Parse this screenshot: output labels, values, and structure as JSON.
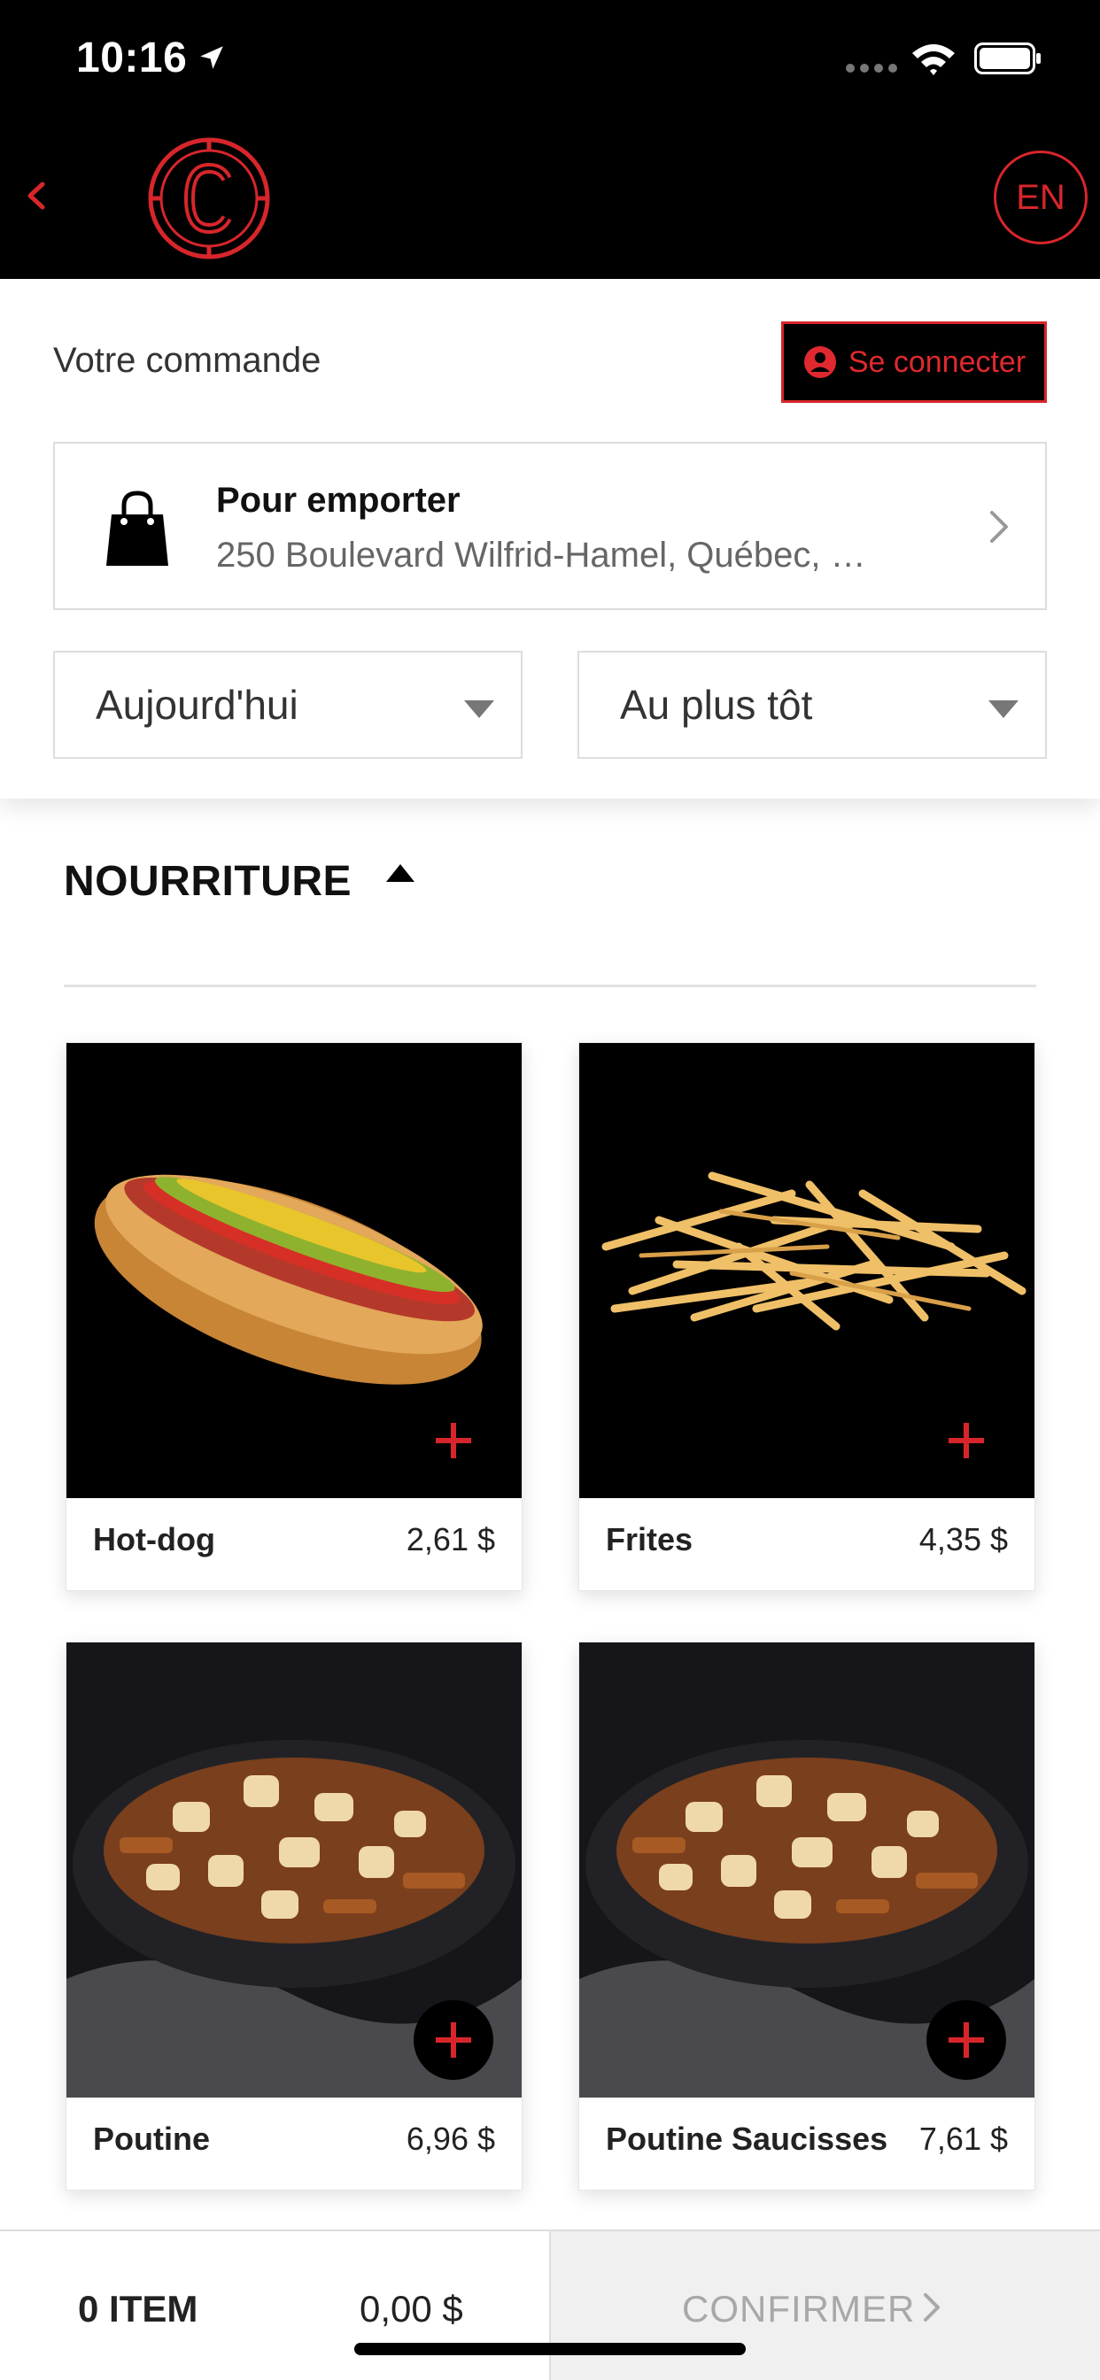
{
  "status_bar": {
    "time": "10:16"
  },
  "header": {
    "lang_label": "EN",
    "logo_letter": "C"
  },
  "order": {
    "title": "Votre commande",
    "login_label": "Se connecter",
    "pickup_title": "Pour emporter",
    "pickup_address": "250 Boulevard Wilfrid-Hamel, Québec, …",
    "date_value": "Aujourd'hui",
    "time_value": "Au plus tôt"
  },
  "category": {
    "title": "NOURRITURE"
  },
  "products": [
    {
      "name": "Hot-dog",
      "price": "2,61 $"
    },
    {
      "name": "Frites",
      "price": "4,35 $"
    },
    {
      "name": "Poutine",
      "price": "6,96 $"
    },
    {
      "name": "Poutine Saucisses",
      "price": "7,61 $"
    }
  ],
  "cart": {
    "item_count": "0 ITEM",
    "total": "0,00 $",
    "confirm_label": "CONFIRMER"
  },
  "colors": {
    "accent": "#d7262b",
    "header_bg": "#000000",
    "confirm_bg": "#f0f0f0"
  }
}
